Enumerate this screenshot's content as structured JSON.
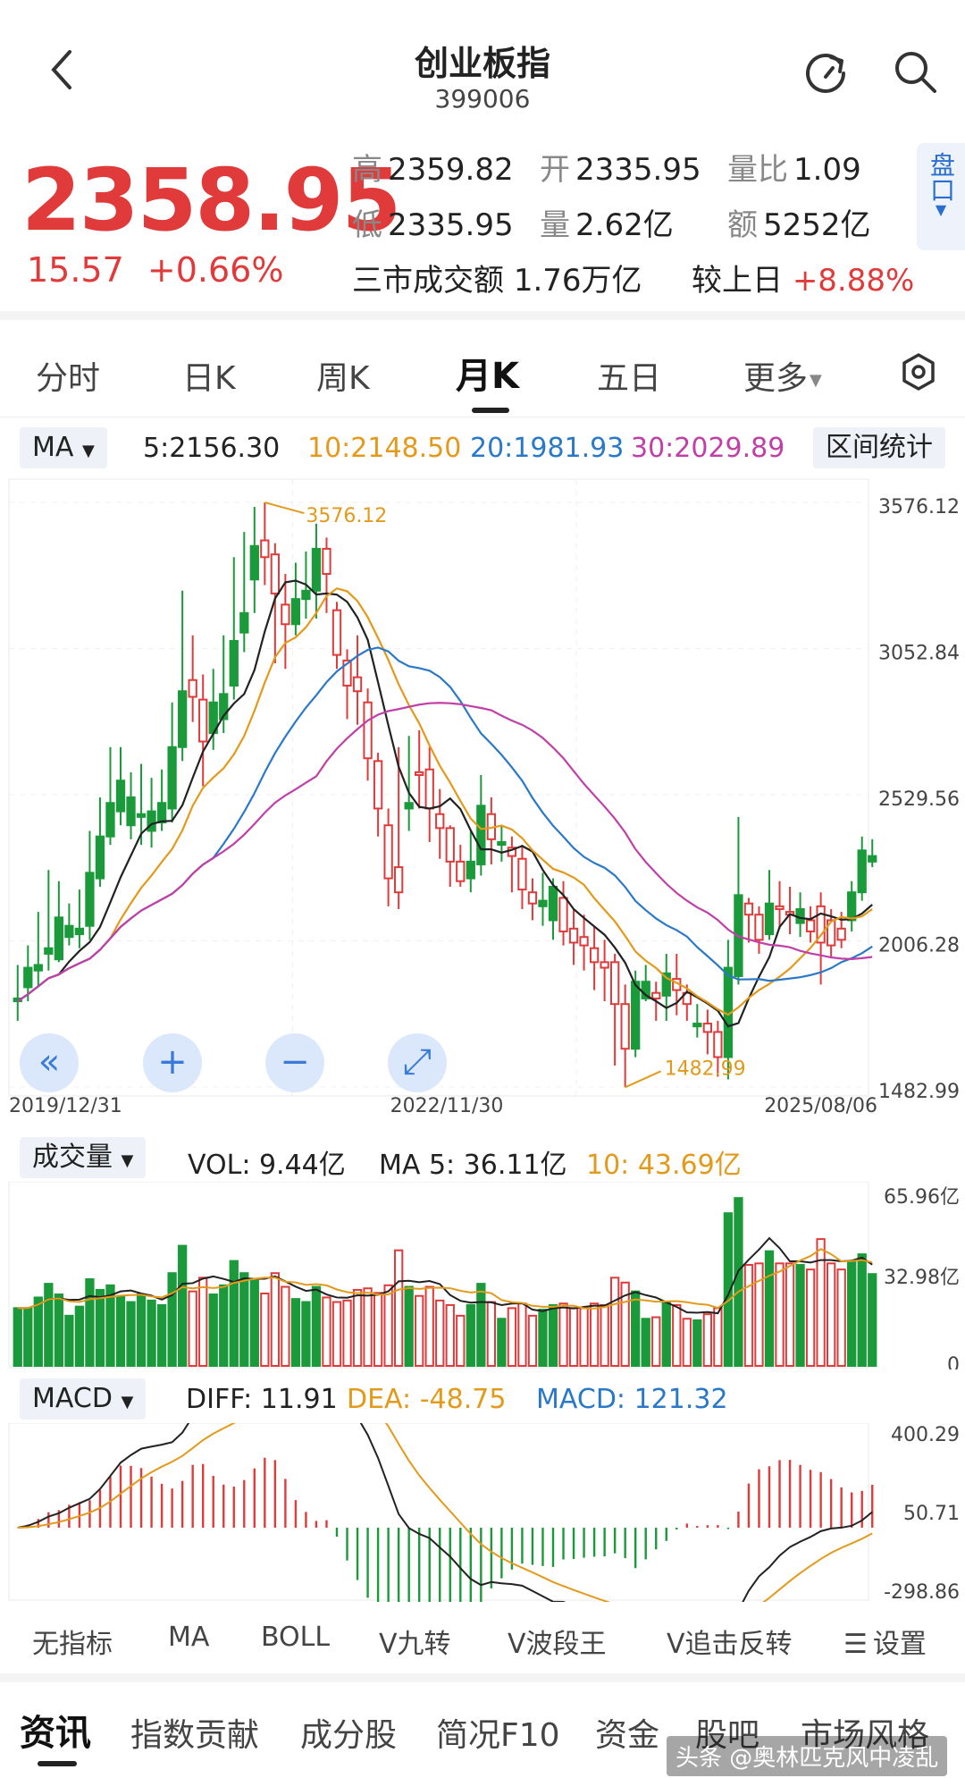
{
  "header": {
    "back_icon": "chevron-left-icon",
    "title": "创业板指",
    "code": "399006",
    "refresh_icon": "refresh-icon",
    "search_icon": "search-icon"
  },
  "quote": {
    "price": "2358.95",
    "change": "15.57",
    "change_pct": "+0.66%",
    "high_label": "高",
    "high": "2359.82",
    "open_label": "开",
    "open": "2335.95",
    "volratio_label": "量比",
    "volratio": "1.09",
    "low_label": "低",
    "low": "2335.95",
    "vol_label": "量",
    "vol": "2.62亿",
    "amount_label": "额",
    "amount": "5252亿",
    "market_turnover_label": "三市成交额",
    "market_turnover": "1.76万亿",
    "vs_prev_label": "较上日",
    "vs_prev": "+8.88%",
    "pankou": "盘口"
  },
  "tabs": [
    {
      "label": "分时"
    },
    {
      "label": "日K"
    },
    {
      "label": "周K"
    },
    {
      "label": "月K",
      "active": true
    },
    {
      "label": "五日"
    },
    {
      "label": "更多"
    }
  ],
  "ma_row": {
    "selector": "MA",
    "ma5": "5:2156.30",
    "ma10": "10:2148.50",
    "ma20": "20:1981.93",
    "ma30": "30:2029.89",
    "interval_stats": "区间统计"
  },
  "vol_row": {
    "selector": "成交量",
    "vol": "VOL: 9.44亿",
    "ma5": "MA 5: 36.11亿",
    "ma10": "10: 43.69亿"
  },
  "macd_row": {
    "selector": "MACD",
    "diff": "DIFF: 11.91",
    "dea": "DEA: -48.75",
    "macd": "MACD: 121.32"
  },
  "colors": {
    "up": "#e03a3a",
    "down": "#1a9a3a",
    "ma5": "#222222",
    "ma10": "#e39a1a",
    "ma20": "#2a78c8",
    "ma30": "#c040a8"
  },
  "chart_data": [
    {
      "type": "candlestick",
      "ylim": [
        1482.99,
        3576.12
      ],
      "ytick_labels": [
        "3576.12",
        "3052.84",
        "2529.56",
        "2006.28",
        "1482.99"
      ],
      "x_labels": [
        "2019/12/31",
        "2022/11/30",
        "2025/08/06"
      ],
      "annotations": [
        "3576.12",
        "1482.99"
      ],
      "candles": [
        [
          1800,
          1920,
          1720,
          1790
        ],
        [
          1910,
          1990,
          1790,
          1840
        ],
        [
          1920,
          2110,
          1840,
          1900
        ],
        [
          1980,
          2260,
          1900,
          1960
        ],
        [
          2090,
          2220,
          1930,
          1940
        ],
        [
          2060,
          2140,
          1990,
          2020
        ],
        [
          2050,
          2190,
          1980,
          2030
        ],
        [
          2250,
          2400,
          2010,
          2060
        ],
        [
          2380,
          2520,
          2200,
          2230
        ],
        [
          2500,
          2700,
          2350,
          2380
        ],
        [
          2580,
          2700,
          2420,
          2470
        ],
        [
          2520,
          2610,
          2370,
          2420
        ],
        [
          2460,
          2640,
          2350,
          2450
        ],
        [
          2470,
          2590,
          2340,
          2400
        ],
        [
          2500,
          2620,
          2400,
          2430
        ],
        [
          2700,
          2860,
          2430,
          2480
        ],
        [
          2900,
          3260,
          2650,
          2700
        ],
        [
          2880,
          3100,
          2790,
          2940
        ],
        [
          2720,
          2960,
          2560,
          2870
        ],
        [
          2860,
          2980,
          2690,
          2750
        ],
        [
          2890,
          3100,
          2750,
          2800
        ],
        [
          3080,
          3380,
          2870,
          2920
        ],
        [
          3180,
          3470,
          3040,
          3110
        ],
        [
          3420,
          3560,
          3180,
          3300
        ],
        [
          3380,
          3576,
          3280,
          3440
        ],
        [
          3250,
          3430,
          3000,
          3390
        ],
        [
          3140,
          3320,
          2980,
          3210
        ],
        [
          3230,
          3360,
          3100,
          3140
        ],
        [
          3260,
          3400,
          3160,
          3230
        ],
        [
          3410,
          3500,
          3160,
          3260
        ],
        [
          3320,
          3450,
          3180,
          3410
        ],
        [
          3030,
          3220,
          2980,
          3190
        ],
        [
          2920,
          3050,
          2800,
          3010
        ],
        [
          2900,
          3100,
          2780,
          2950
        ],
        [
          2660,
          2910,
          2580,
          2860
        ],
        [
          2480,
          2680,
          2380,
          2650
        ],
        [
          2230,
          2480,
          2130,
          2420
        ],
        [
          2180,
          2700,
          2120,
          2270
        ],
        [
          2500,
          2740,
          2400,
          2480
        ],
        [
          2600,
          2760,
          2480,
          2610
        ],
        [
          2480,
          2700,
          2360,
          2620
        ],
        [
          2410,
          2550,
          2300,
          2460
        ],
        [
          2290,
          2420,
          2200,
          2410
        ],
        [
          2220,
          2350,
          2200,
          2290
        ],
        [
          2290,
          2400,
          2180,
          2230
        ],
        [
          2490,
          2600,
          2240,
          2280
        ],
        [
          2370,
          2520,
          2280,
          2460
        ],
        [
          2360,
          2420,
          2290,
          2350
        ],
        [
          2310,
          2380,
          2180,
          2340
        ],
        [
          2190,
          2350,
          2120,
          2300
        ],
        [
          2140,
          2230,
          2080,
          2180
        ],
        [
          2150,
          2250,
          2060,
          2130
        ],
        [
          2200,
          2230,
          2010,
          2080
        ],
        [
          2040,
          2220,
          1990,
          2160
        ],
        [
          2000,
          2120,
          1920,
          2050
        ],
        [
          1990,
          2100,
          1900,
          2020
        ],
        [
          1930,
          2060,
          1830,
          1980
        ],
        [
          1910,
          2010,
          1790,
          1930
        ],
        [
          1780,
          1960,
          1560,
          1930
        ],
        [
          1620,
          1850,
          1482,
          1780
        ],
        [
          1860,
          1900,
          1590,
          1620
        ],
        [
          1860,
          1920,
          1790,
          1800
        ],
        [
          1800,
          1860,
          1720,
          1820
        ],
        [
          1890,
          1960,
          1720,
          1810
        ],
        [
          1830,
          1960,
          1740,
          1870
        ],
        [
          1780,
          1850,
          1720,
          1820
        ],
        [
          1710,
          1780,
          1660,
          1700
        ],
        [
          1680,
          1760,
          1600,
          1710
        ],
        [
          1590,
          1720,
          1520,
          1680
        ],
        [
          1910,
          2010,
          1510,
          1590
        ],
        [
          2170,
          2450,
          1850,
          1880
        ],
        [
          2100,
          2160,
          2000,
          2140
        ],
        [
          2010,
          2130,
          1960,
          2100
        ],
        [
          2140,
          2260,
          2010,
          2030
        ],
        [
          2120,
          2220,
          2050,
          2130
        ],
        [
          2100,
          2200,
          2030,
          2110
        ],
        [
          2120,
          2180,
          2020,
          2070
        ],
        [
          2040,
          2130,
          2000,
          2080
        ],
        [
          2000,
          2180,
          1850,
          2130
        ],
        [
          1990,
          2120,
          1950,
          2080
        ],
        [
          2010,
          2110,
          1980,
          2050
        ],
        [
          2180,
          2220,
          2040,
          2080
        ],
        [
          2330,
          2380,
          2150,
          2180
        ],
        [
          2310,
          2370,
          2270,
          2290
        ]
      ]
    },
    {
      "type": "bar",
      "title": "成交量",
      "ytick_labels": [
        "65.96亿",
        "32.98亿",
        "0"
      ],
      "ylim": [
        0,
        65.96
      ]
    },
    {
      "type": "bar",
      "title": "MACD",
      "ytick_labels": [
        "400.29",
        "50.71",
        "-298.86"
      ],
      "ylim": [
        -298.86,
        400.29
      ]
    }
  ],
  "nav_buttons": [
    {
      "icon": "double-chevron-left-icon",
      "glyph": "«"
    },
    {
      "icon": "zoom-in-icon",
      "glyph": "+"
    },
    {
      "icon": "zoom-out-icon",
      "glyph": "−"
    },
    {
      "icon": "expand-icon",
      "glyph": "⤢"
    }
  ],
  "bottom_indicators": [
    {
      "label": "无指标"
    },
    {
      "label": "MA",
      "active": true
    },
    {
      "label": "BOLL"
    },
    {
      "label": "V九转"
    },
    {
      "label": "V波段王"
    },
    {
      "label": "V追击反转"
    },
    {
      "label": "设置"
    }
  ],
  "bottom_tabs": [
    {
      "label": "资讯",
      "active": true
    },
    {
      "label": "指数贡献"
    },
    {
      "label": "成分股"
    },
    {
      "label": "简况F10"
    },
    {
      "label": "资金"
    },
    {
      "label": "股吧"
    },
    {
      "label": "市场风格"
    }
  ],
  "watermark": "头条 @奥林匹克风中凌乱"
}
